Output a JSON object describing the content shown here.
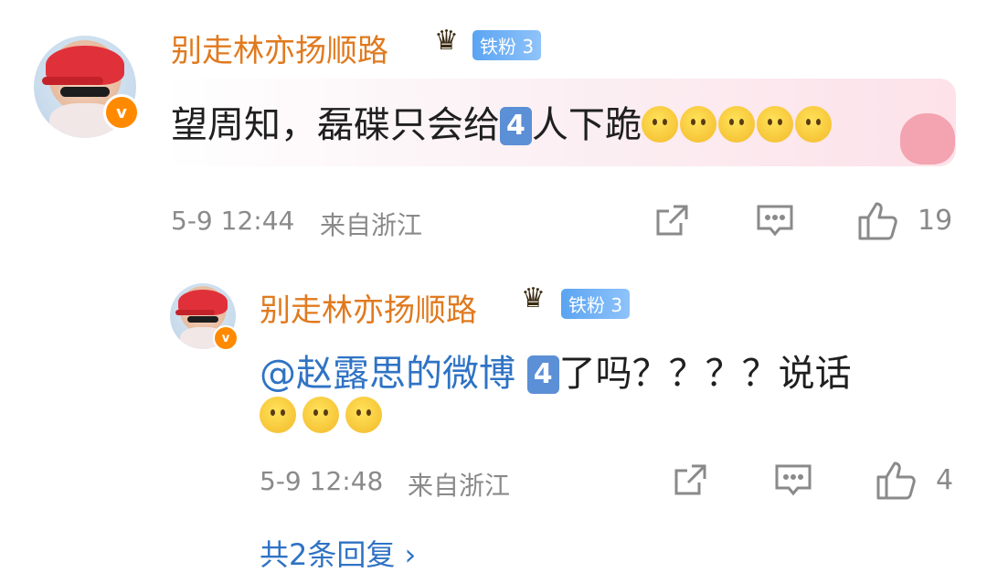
{
  "comment": {
    "username": "别走林亦扬顺路",
    "badge": "铁粉 3",
    "text_before": "望周知，磊碟只会给",
    "keycap": "4",
    "text_after": "人下跪",
    "time": "5-9 12:44",
    "location": "来自浙江",
    "likes": "19",
    "emoji_count": 5,
    "verified_mark": "v"
  },
  "reply": {
    "username": "别走林亦扬顺路",
    "badge": "铁粉 3",
    "mention": "@赵露思的微博",
    "keycap": "4",
    "text_after": "了吗？？？？说话",
    "time": "5-9 12:48",
    "location": "来自浙江",
    "likes": "4",
    "emoji_count": 3,
    "verified_mark": "v"
  },
  "footer": {
    "replies_link": "共2条回复 ›"
  },
  "icons": [
    "crown-icon",
    "share-icon",
    "comment-icon",
    "like-icon"
  ],
  "colors": {
    "username": "#e07a1f",
    "meta": "#8a8a8a",
    "link": "#2f73c4",
    "badge": "#5aa4f2"
  }
}
